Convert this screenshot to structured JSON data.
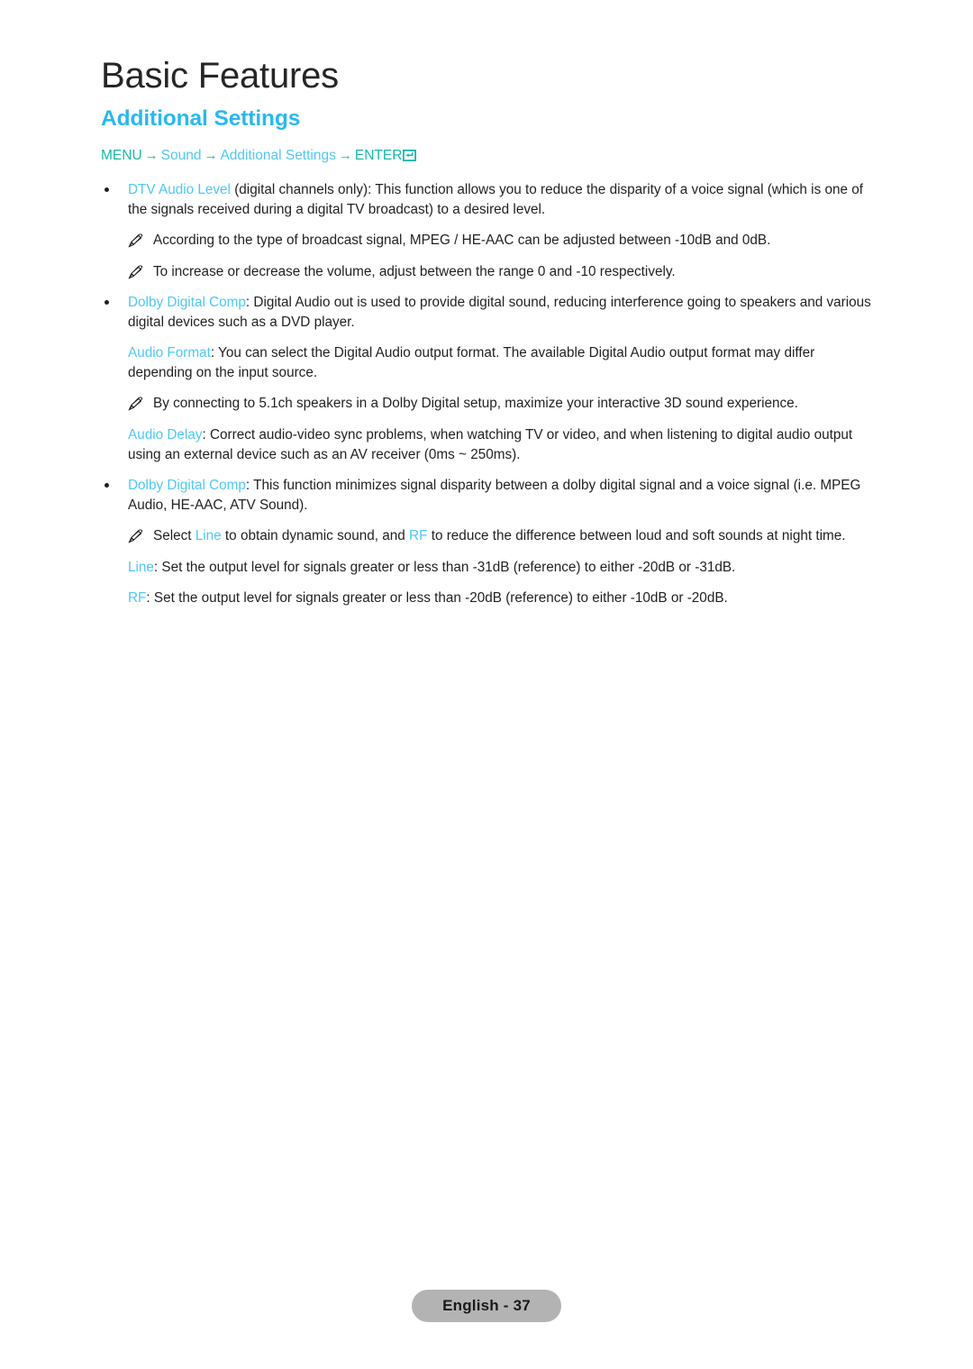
{
  "document": {
    "chapter_title": "Basic Features",
    "section_title": "Additional Settings"
  },
  "colors": {
    "accent_blue": "#29b8ef",
    "term_blue": "#4ec8f5",
    "menu_teal": "#17b8a6",
    "body_text": "#231f20",
    "badge_bg": "#b3b3b3",
    "page_bg": "#ffffff"
  },
  "breadcrumb": {
    "menu": "MENU",
    "arrow1": "→",
    "sound": "Sound",
    "arrow2": "→",
    "additional_settings": "Additional Settings",
    "arrow3": "→",
    "enter": "ENTER",
    "enter_icon": "enter-key-icon"
  },
  "blocks": [
    {
      "kind": "bullet",
      "term": "DTV Audio Level",
      "text": " (digital channels only): This function allows you to reduce the disparity of a voice signal (which is one of the signals received during a digital TV broadcast) to a desired level."
    },
    {
      "kind": "note",
      "icon": "pencil-note-icon",
      "text": "According to the type of broadcast signal, MPEG / HE-AAC can be adjusted between -10dB and 0dB."
    },
    {
      "kind": "note",
      "icon": "pencil-note-icon",
      "text": "To increase or decrease the volume, adjust between the range 0 and -10 respectively."
    },
    {
      "kind": "bullet",
      "term": "Dolby Digital Comp",
      "text": ": Digital Audio out is used to provide digital sound, reducing interference going to speakers and various digital devices such as a DVD player."
    },
    {
      "kind": "sub",
      "term": "Audio Format",
      "text": ": You can select the Digital Audio output format. The available Digital Audio output format may differ depending on the input source."
    },
    {
      "kind": "note",
      "icon": "pencil-note-icon",
      "text": "By connecting to 5.1ch speakers in a Dolby Digital setup, maximize your interactive 3D sound experience."
    },
    {
      "kind": "sub",
      "term": "Audio Delay",
      "text": ": Correct audio-video sync problems, when watching TV or video, and when listening to digital audio output using an external device such as an AV receiver (0ms ~ 250ms)."
    },
    {
      "kind": "bullet",
      "term": "Dolby Digital Comp",
      "text": ": This function minimizes signal disparity between a dolby digital signal and a voice signal (i.e. MPEG Audio, HE-AAC, ATV Sound)."
    },
    {
      "kind": "note-multiterm",
      "icon": "pencil-note-icon",
      "seg1": "Select ",
      "term1": "Line",
      "seg2": " to obtain dynamic sound, and ",
      "term2": "RF",
      "seg3": " to reduce the difference between loud and soft sounds at night time."
    },
    {
      "kind": "sub",
      "term": "Line",
      "text": ": Set the output level for signals greater or less than -31dB (reference) to either -20dB or -31dB."
    },
    {
      "kind": "sub",
      "term": "RF",
      "text": ": Set the output level for signals greater or less than -20dB (reference) to either -10dB or -20dB."
    }
  ],
  "footer": {
    "page_label": "English - 37"
  }
}
